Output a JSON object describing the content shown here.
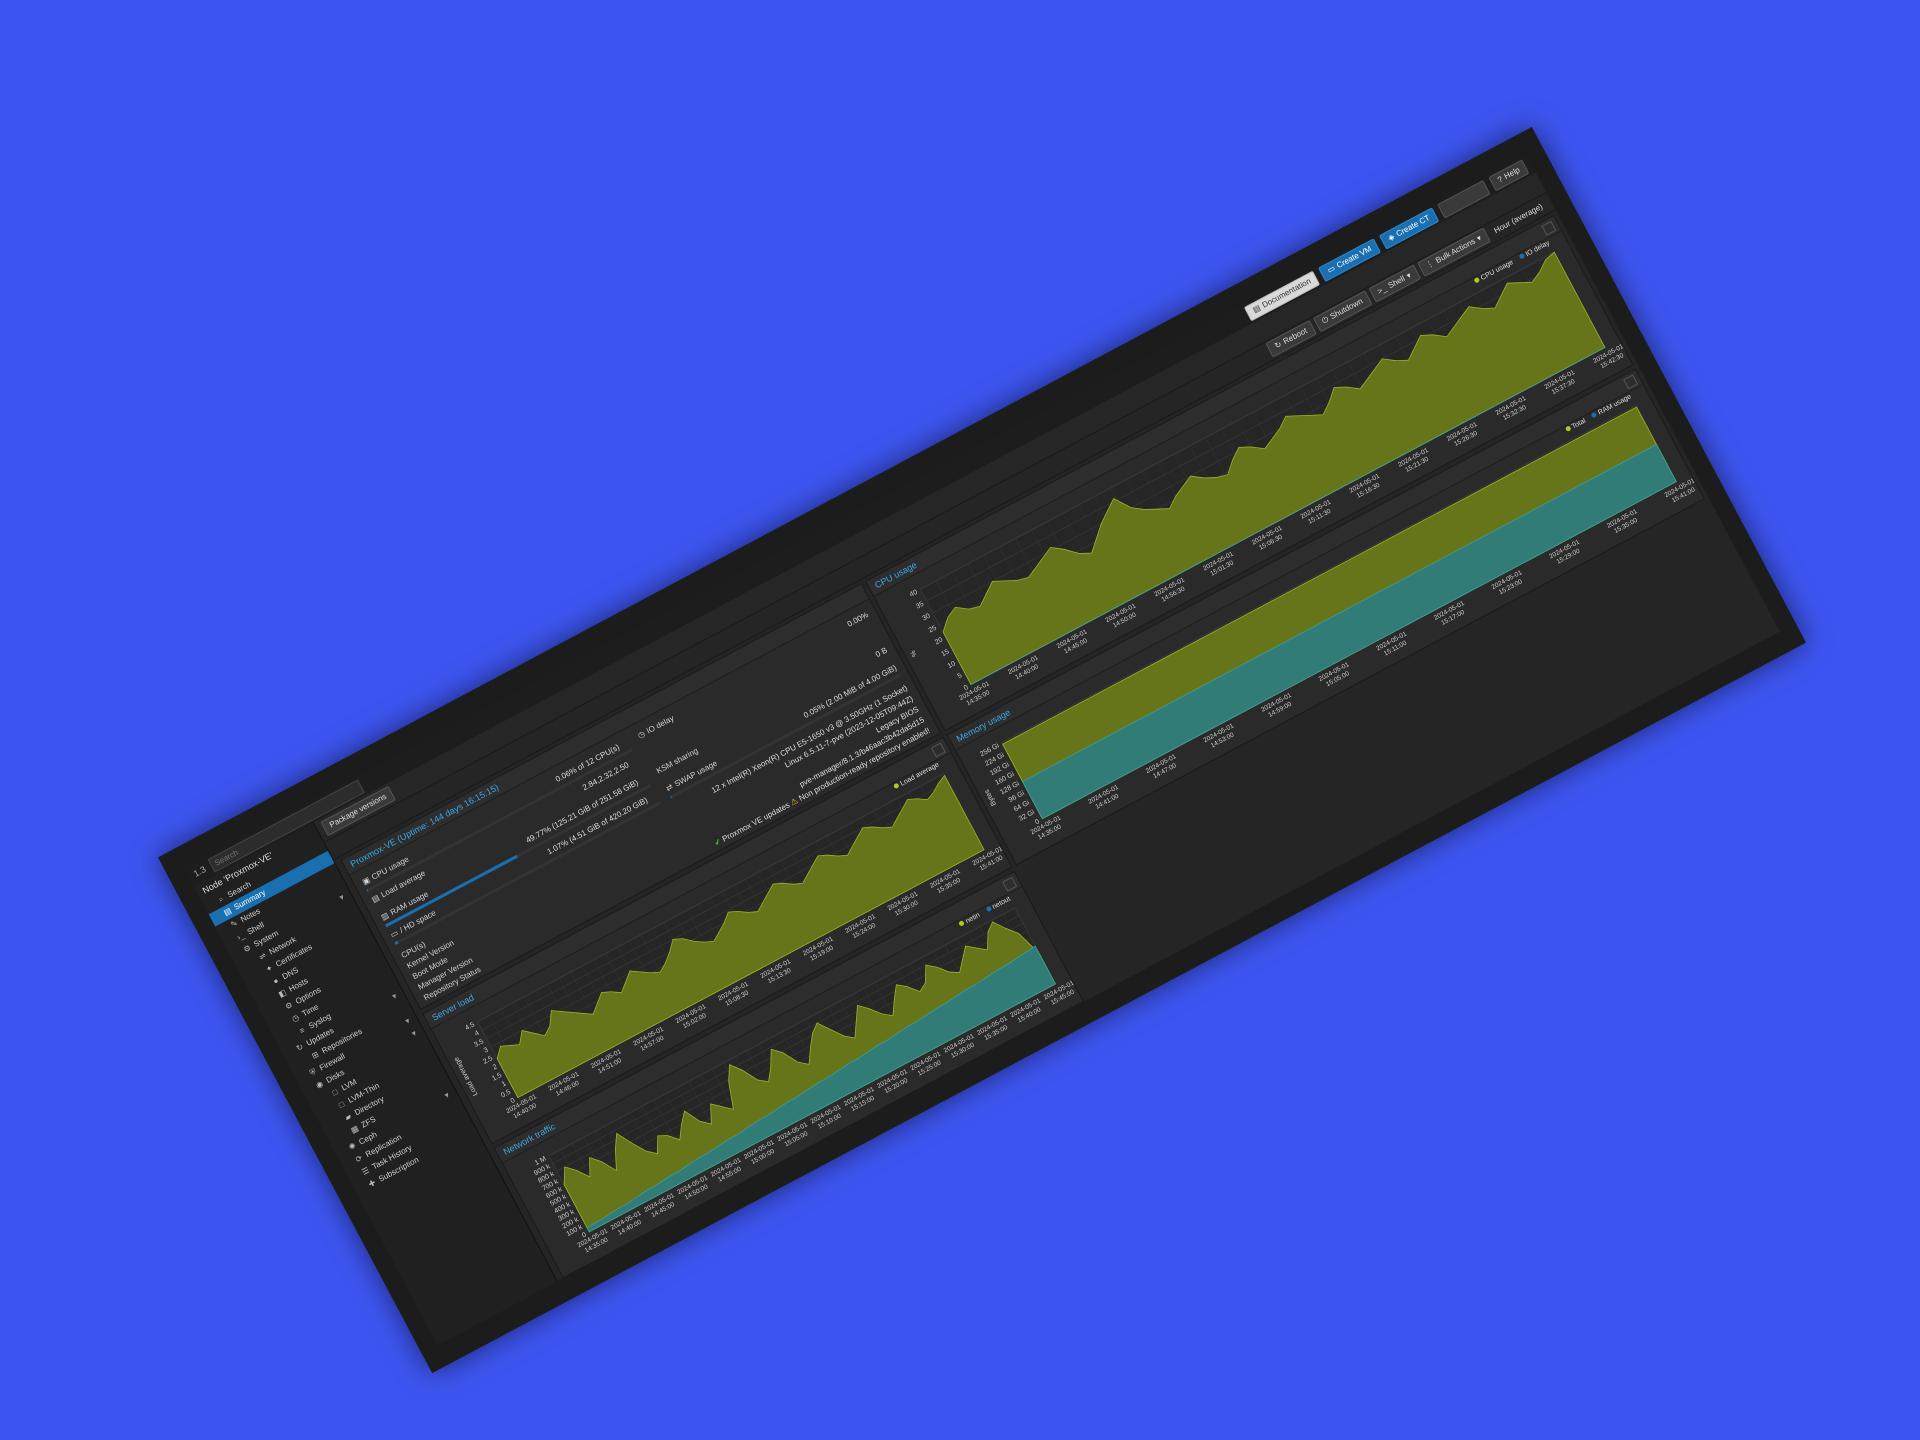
{
  "topbar": {
    "version": "1.3",
    "search_placeholder": "Search",
    "buttons": {
      "documentation": "Documentation",
      "create_vm": "Create VM",
      "create_ct": "Create CT",
      "help": "Help"
    }
  },
  "nav": {
    "title": "Node 'Proxmox-VE'",
    "items": [
      {
        "label": "Search",
        "icon": "search-icon",
        "sub": false,
        "active": false
      },
      {
        "label": "Summary",
        "icon": "book-icon",
        "sub": false,
        "active": true
      },
      {
        "label": "Notes",
        "icon": "notes-icon",
        "sub": false,
        "active": false
      },
      {
        "label": "Shell",
        "icon": "terminal-icon",
        "sub": false,
        "active": false
      },
      {
        "label": "System",
        "icon": "gears-icon",
        "sub": false,
        "active": false,
        "chevron": true
      },
      {
        "label": "Network",
        "icon": "network-icon",
        "sub": true,
        "active": false
      },
      {
        "label": "Certificates",
        "icon": "certificate-icon",
        "sub": true,
        "active": false
      },
      {
        "label": "DNS",
        "icon": "globe-icon",
        "sub": true,
        "active": false
      },
      {
        "label": "Hosts",
        "icon": "hosts-icon",
        "sub": true,
        "active": false
      },
      {
        "label": "Options",
        "icon": "gear-icon",
        "sub": true,
        "active": false
      },
      {
        "label": "Time",
        "icon": "clock-icon",
        "sub": true,
        "active": false
      },
      {
        "label": "Syslog",
        "icon": "list-icon",
        "sub": true,
        "active": false
      },
      {
        "label": "Updates",
        "icon": "refresh-icon",
        "sub": false,
        "active": false,
        "chevron": true
      },
      {
        "label": "Repositories",
        "icon": "repository-icon",
        "sub": true,
        "active": false
      },
      {
        "label": "Firewall",
        "icon": "shield-icon",
        "sub": false,
        "active": false,
        "chevron": true
      },
      {
        "label": "Disks",
        "icon": "disk-icon",
        "sub": false,
        "active": false,
        "chevron": true
      },
      {
        "label": "LVM",
        "icon": "square-icon",
        "sub": true,
        "active": false
      },
      {
        "label": "LVM-Thin",
        "icon": "square-icon",
        "sub": true,
        "active": false
      },
      {
        "label": "Directory",
        "icon": "folder-icon",
        "sub": true,
        "active": false
      },
      {
        "label": "ZFS",
        "icon": "zfs-icon",
        "sub": true,
        "active": false
      },
      {
        "label": "Ceph",
        "icon": "ceph-icon",
        "sub": false,
        "active": false,
        "chevron": true
      },
      {
        "label": "Replication",
        "icon": "replication-icon",
        "sub": false,
        "active": false
      },
      {
        "label": "Task History",
        "icon": "history-icon",
        "sub": false,
        "active": false
      },
      {
        "label": "Subscription",
        "icon": "support-icon",
        "sub": false,
        "active": false
      }
    ]
  },
  "toolbar": {
    "package_versions": "Package versions",
    "reboot": "Reboot",
    "shutdown": "Shutdown",
    "shell": "Shell",
    "bulk_actions": "Bulk Actions",
    "timeframe": "Hour (average)"
  },
  "status": {
    "title": "Proxmox-VE (Uptime: 144 days 16:15:15)",
    "cpu_label": "CPU usage",
    "cpu_value": "0.06% of 12 CPU(s)",
    "cpu_fraction": 0.0006,
    "io_delay_label": "IO delay",
    "io_delay_value": "0.00%",
    "load_label": "Load average",
    "load_value": "2.84,2.32,2.50",
    "ram_label": "RAM usage",
    "ram_value": "49.77% (125.21 GiB of 251.58 GiB)",
    "ram_fraction": 0.4977,
    "ksm_label": "KSM sharing",
    "ksm_value": "0 B",
    "hd_label": "/ HD space",
    "hd_value": "1.07% (4.51 GiB of 420.20 GiB)",
    "hd_fraction": 0.0107,
    "swap_label": "SWAP usage",
    "swap_value": "0.05% (2.00 MiB of 4.00 GiB)",
    "swap_fraction": 0.0005,
    "cpus_label": "CPU(s)",
    "cpus_value": "12 x Intel(R) Xeon(R) CPU E5-1650 v3 @ 3.50GHz (1 Socket)",
    "kernel_label": "Kernel Version",
    "kernel_value": "Linux 6.5.11-7-pve (2023-12-05T09:44Z)",
    "boot_label": "Boot Mode",
    "boot_value": "Legacy BIOS",
    "manager_label": "Manager Version",
    "manager_value": "pve-manager/8.1.3/b46aac3b42da5d15",
    "repo_label": "Repository Status",
    "repo_ok": "Proxmox VE updates",
    "repo_warn": "Non production-ready repository enabled!"
  },
  "colors": {
    "accent": "#1a6fb0",
    "chart_primary": "#6b7a1a",
    "chart_secondary": "#2f7d7d",
    "legend_primary": "#b6c721",
    "legend_secondary": "#1a6fb0"
  },
  "chart_data": [
    {
      "id": "cpu",
      "type": "area",
      "title": "CPU usage",
      "ylabel": "%",
      "ylim": [
        0,
        40
      ],
      "yticks": [
        "0",
        "5",
        "10",
        "15",
        "20",
        "25",
        "30",
        "35",
        "40"
      ],
      "xlabels": [
        [
          "2024-05-01",
          "14:35:00"
        ],
        [
          "2024-05-01",
          "14:40:00"
        ],
        [
          "2024-05-01",
          "14:45:00"
        ],
        [
          "2024-05-01",
          "14:50:00"
        ],
        [
          "2024-05-01",
          "14:56:30"
        ],
        [
          "2024-05-01",
          "15:01:30"
        ],
        [
          "2024-05-01",
          "15:06:30"
        ],
        [
          "2024-05-01",
          "15:11:30"
        ],
        [
          "2024-05-01",
          "15:16:30"
        ],
        [
          "2024-05-01",
          "15:21:30"
        ],
        [
          "2024-05-01",
          "15:26:30"
        ],
        [
          "2024-05-01",
          "15:32:30"
        ],
        [
          "2024-05-01",
          "15:37:30"
        ],
        [
          "2024-05-01",
          "15:42:30"
        ]
      ],
      "series": [
        {
          "name": "CPU usage",
          "values": [
            22,
            26,
            28,
            25,
            24,
            27,
            30,
            28,
            26,
            25,
            27,
            29,
            31,
            28,
            24,
            22,
            26,
            30,
            33,
            36,
            30,
            27,
            25,
            23,
            26,
            28,
            30,
            27,
            25,
            24,
            28,
            31,
            29,
            26,
            28,
            30,
            33,
            31,
            29,
            27,
            30,
            34,
            32,
            29,
            31,
            33,
            35,
            32,
            30,
            33,
            36,
            34,
            31,
            33,
            35,
            37,
            34,
            32,
            35,
            38,
            36,
            34,
            36,
            39,
            40
          ]
        },
        {
          "name": "IO delay",
          "values": [
            0,
            0,
            0,
            0,
            0,
            0,
            0,
            0,
            0,
            0,
            0,
            0,
            0,
            0,
            0,
            0,
            0,
            0,
            0,
            0,
            0,
            0,
            0,
            0,
            0,
            0,
            0,
            0,
            0,
            0,
            0,
            0,
            0,
            0,
            0,
            0,
            0,
            0,
            0,
            0,
            0,
            0,
            0,
            0,
            0,
            0,
            0,
            0,
            0,
            0,
            0,
            0,
            0,
            0,
            0,
            0,
            0,
            0,
            0,
            0,
            0,
            0,
            0,
            0,
            0
          ]
        }
      ]
    },
    {
      "id": "load",
      "type": "area",
      "title": "Server load",
      "ylabel": "Load average",
      "ylim": [
        0,
        4.5
      ],
      "yticks": [
        "0",
        "0.5",
        "1",
        "1.5",
        "2",
        "2.5",
        "3",
        "3.5",
        "4",
        "4.5"
      ],
      "xlabels": [
        [
          "2024-05-01",
          "14:40:00"
        ],
        [
          "2024-05-01",
          "14:46:00"
        ],
        [
          "2024-05-01",
          "14:51:00"
        ],
        [
          "2024-05-01",
          "14:57:00"
        ],
        [
          "2024-05-01",
          "15:02:00"
        ],
        [
          "2024-05-01",
          "15:08:30"
        ],
        [
          "2024-05-01",
          "15:13:30"
        ],
        [
          "2024-05-01",
          "15:19:00"
        ],
        [
          "2024-05-01",
          "15:24:00"
        ],
        [
          "2024-05-01",
          "15:30:00"
        ],
        [
          "2024-05-01",
          "15:35:00"
        ],
        [
          "2024-05-01",
          "15:41:00"
        ]
      ],
      "series": [
        {
          "name": "Load average",
          "values": [
            2.3,
            2.8,
            2.6,
            2.4,
            3.0,
            2.6,
            2.2,
            2.5,
            3.2,
            2.9,
            2.6,
            2.3,
            2.0,
            2.4,
            2.8,
            2.6,
            2.3,
            2.7,
            3.1,
            2.8,
            2.5,
            2.3,
            2.6,
            3.0,
            3.5,
            3.3,
            2.9,
            2.6,
            2.4,
            2.7,
            3.0,
            3.4,
            3.2,
            2.9,
            2.7,
            3.0,
            3.3,
            3.6,
            3.4,
            3.1,
            2.9,
            3.2,
            3.5,
            3.8,
            3.6,
            3.3,
            3.1,
            3.4,
            3.7,
            4.0,
            3.8,
            3.5,
            3.3,
            3.6,
            3.9,
            4.2,
            4.0,
            3.7,
            3.9,
            4.2,
            4.4
          ]
        }
      ]
    },
    {
      "id": "memory",
      "type": "area",
      "title": "Memory usage",
      "ylabel": "Bytes",
      "ylim": [
        0,
        256
      ],
      "yticks": [
        "0",
        "32 Gi",
        "64 Gi",
        "96 Gi",
        "128 Gi",
        "160 Gi",
        "192 Gi",
        "224 Gi",
        "256 Gi"
      ],
      "xlabels": [
        [
          "2024-05-01",
          "14:35:00"
        ],
        [
          "2024-05-01",
          "14:41:00"
        ],
        [
          "2024-05-01",
          "14:47:00"
        ],
        [
          "2024-05-01",
          "14:53:00"
        ],
        [
          "2024-05-01",
          "14:59:00"
        ],
        [
          "2024-05-01",
          "15:05:00"
        ],
        [
          "2024-05-01",
          "15:11:00"
        ],
        [
          "2024-05-01",
          "15:17:00"
        ],
        [
          "2024-05-01",
          "15:23:00"
        ],
        [
          "2024-05-01",
          "15:29:00"
        ],
        [
          "2024-05-01",
          "15:35:00"
        ],
        [
          "2024-05-01",
          "15:41:00"
        ]
      ],
      "series": [
        {
          "name": "Total",
          "values": [
            251.58,
            251.58
          ]
        },
        {
          "name": "RAM usage",
          "values": [
            125.21,
            125.21
          ]
        }
      ]
    },
    {
      "id": "network",
      "type": "area",
      "title": "Network traffic",
      "ylim": [
        0,
        1000000
      ],
      "yticks": [
        "0",
        "100 k",
        "200 k",
        "300 k",
        "400 k",
        "500 k",
        "600 k",
        "700 k",
        "800 k",
        "900 k",
        "1 M"
      ],
      "xlabels": [
        [
          "2024-05-01",
          "14:35:00"
        ],
        [
          "2024-05-01",
          "14:40:00"
        ],
        [
          "2024-05-01",
          "14:45:00"
        ],
        [
          "2024-05-01",
          "14:50:00"
        ],
        [
          "2024-05-01",
          "14:55:00"
        ],
        [
          "2024-05-01",
          "15:00:00"
        ],
        [
          "2024-05-01",
          "15:05:00"
        ],
        [
          "2024-05-01",
          "15:10:00"
        ],
        [
          "2024-05-01",
          "15:15:00"
        ],
        [
          "2024-05-01",
          "15:20:00"
        ],
        [
          "2024-05-01",
          "15:25:00"
        ],
        [
          "2024-05-01",
          "15:30:00"
        ],
        [
          "2024-05-01",
          "15:35:00"
        ],
        [
          "2024-05-01",
          "15:40:00"
        ],
        [
          "2024-05-01",
          "15:45:00"
        ]
      ],
      "series": [
        {
          "name": "netin",
          "values": [
            620000,
            800000,
            700000,
            560000,
            760000,
            650000,
            480000,
            700000,
            860000,
            680000,
            520000,
            430000,
            610000,
            560000,
            450000,
            600000,
            720000,
            530000,
            440000,
            650000,
            560000,
            470000,
            780000,
            950000,
            820000,
            640000,
            560000,
            700000,
            880000,
            780000,
            600000,
            520000,
            680000,
            820000,
            900000,
            760000,
            620000,
            540000,
            700000,
            860000,
            760000,
            640000,
            560000,
            720000,
            860000,
            780000,
            660000,
            720000,
            900000,
            820000,
            700000,
            640000,
            760000,
            880000,
            800000,
            720000,
            900000,
            980000,
            840000,
            720000,
            400000
          ]
        },
        {
          "name": "netout",
          "values": [
            50000,
            60000,
            60000,
            70000,
            80000,
            80000,
            90000,
            100000,
            110000,
            110000,
            120000,
            130000,
            130000,
            140000,
            150000,
            160000,
            160000,
            170000,
            180000,
            190000,
            190000,
            200000,
            210000,
            220000,
            220000,
            230000,
            240000,
            250000,
            250000,
            260000,
            270000,
            280000,
            280000,
            290000,
            300000,
            310000,
            310000,
            320000,
            330000,
            340000,
            340000,
            350000,
            360000,
            370000,
            370000,
            380000,
            390000,
            400000,
            400000,
            410000,
            420000,
            430000,
            430000,
            440000,
            450000,
            460000,
            460000,
            470000,
            480000,
            490000,
            500000
          ]
        }
      ]
    }
  ]
}
